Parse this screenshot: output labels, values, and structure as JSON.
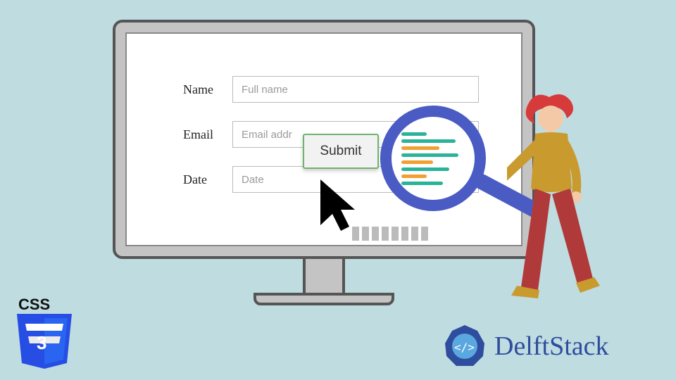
{
  "form": {
    "name_label": "Name",
    "name_placeholder": "Full name",
    "email_label": "Email",
    "email_placeholder": "Email addr",
    "date_label": "Date",
    "date_placeholder": "Date",
    "submit_label": "Submit"
  },
  "brand": {
    "css3": "CSS",
    "delft": "DelftStack"
  },
  "colors": {
    "bg": "#bfdce0",
    "accent": "#4a5cc4",
    "css3": "#264de4"
  }
}
